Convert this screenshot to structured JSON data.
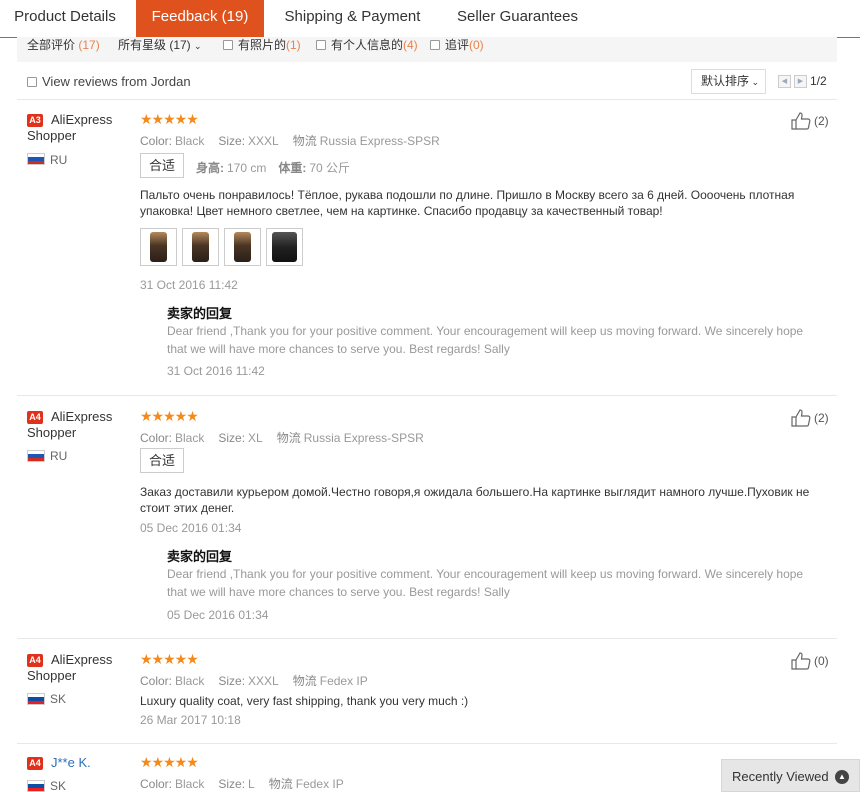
{
  "tabs": [
    "Product Details",
    "Feedback (19)",
    "Shipping & Payment",
    "Seller Guarantees"
  ],
  "filter": {
    "all_label": "全部评价",
    "all_count": "(17)",
    "stars_label": "所有星级 (17)",
    "photos_label": "有照片的",
    "photos_count": "(1)",
    "personal_label": "有个人信息的",
    "personal_count": "(4)",
    "additional_label": "追评",
    "additional_count": "(0)"
  },
  "jordan_label": "View reviews from Jordan",
  "sort_label": "默认排序",
  "pager": "1/2",
  "labels": {
    "color": "Color:",
    "size": "Size:",
    "logistics": "物流",
    "height": "身高:",
    "weight": "体重:",
    "fit": "合适",
    "reply_title": "卖家的回复"
  },
  "reviews": [
    {
      "badge": "A3",
      "name": "AliExpress Shopper",
      "country": "RU",
      "color": "Black",
      "size": "XXXL",
      "logistics": "Russia Express-SPSR",
      "height": "170 cm",
      "weight": "70 公斤",
      "text": "Пальто очень понравилось! Тёплое, рукава подошли по длине. Пришло в Москву всего за 6 дней. Оооочень плотная упаковка! Цвет немного светлее, чем на картинке. Спасибо продавцу за качественный товар!",
      "date": "31 Oct 2016 11:42",
      "reply": "Dear friend ,Thank you for your positive comment. Your encouragement will keep us moving forward. We sincerely hope that we will have more chances to serve you. Best regards! Sally",
      "reply_date": "31 Oct 2016 11:42",
      "likes": "(2)"
    },
    {
      "badge": "A4",
      "name": "AliExpress Shopper",
      "country": "RU",
      "color": "Black",
      "size": "XL",
      "logistics": "Russia Express-SPSR",
      "text": "Заказ доставили курьером домой.Честно говоря,я ожидала большего.На картинке выглядит намного лучше.Пуховик не стоит этих денег.",
      "date": "05 Dec 2016 01:34",
      "reply": "Dear friend ,Thank you for your positive comment. Your encouragement will keep us moving forward. We sincerely hope that we will have more chances to serve you. Best regards! Sally",
      "reply_date": "05 Dec 2016 01:34",
      "likes": "(2)"
    },
    {
      "badge": "A4",
      "name": "AliExpress Shopper",
      "country": "SK",
      "color": "Black",
      "size": "XXXL",
      "logistics": "Fedex IP",
      "text": "Luxury quality coat, very fast shipping, thank you very much :)",
      "date": "26 Mar 2017 10:18",
      "likes": "(0)"
    },
    {
      "badge": "A4",
      "name": "J**e K.",
      "country": "SK",
      "color": "Black",
      "size": "L",
      "logistics": "Fedex IP"
    }
  ],
  "recently_viewed": "Recently Viewed",
  "colors": {
    "accent": "#e0521d",
    "star": "#f48a1c",
    "badge": "#e0311d",
    "count": "#e8834c"
  }
}
